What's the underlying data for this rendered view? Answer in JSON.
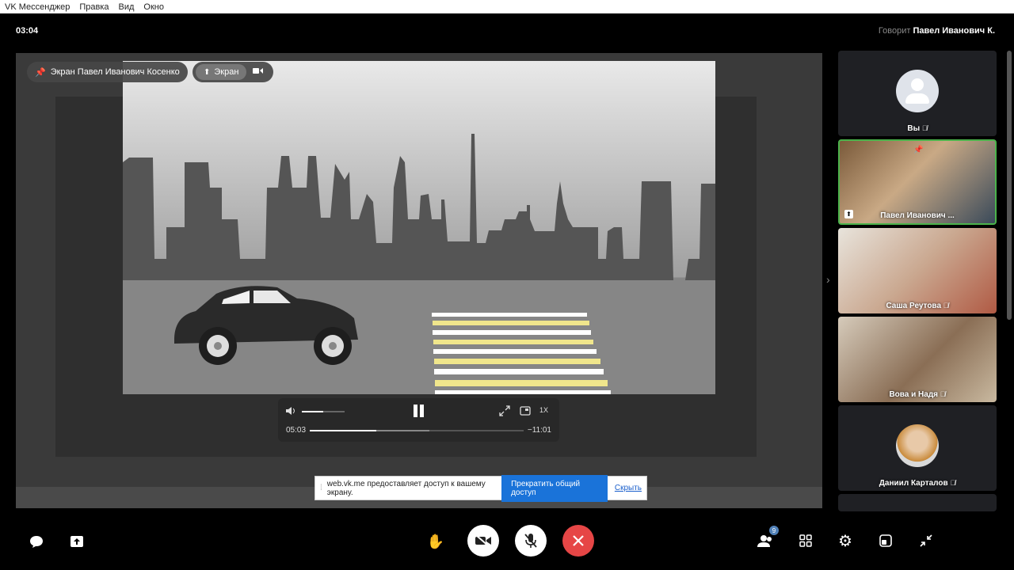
{
  "menubar": {
    "items": [
      "VK Мессенджер",
      "Правка",
      "Вид",
      "Окно"
    ]
  },
  "call": {
    "timer": "03:04",
    "speaking_label": "Говорит",
    "speaking_name": "Павел Иванович К."
  },
  "screen_share": {
    "chip_label": "Экран Павел Иванович Косенко",
    "toggle_label": "Экран"
  },
  "player": {
    "elapsed": "05:03",
    "remaining": "−11:01",
    "speed": "1X",
    "volume_fraction": 0.5,
    "progress_fraction": 0.31
  },
  "share_notice": {
    "message": "web.vk.me предоставляет доступ к вашему экрану.",
    "stop_button": "Прекратить общий доступ",
    "hide_link": "Скрыть"
  },
  "participants": [
    {
      "name": "Вы",
      "muted": true,
      "type": "avatar"
    },
    {
      "name": "Павел Иванович ...",
      "muted": false,
      "type": "video",
      "active": true
    },
    {
      "name": "Саша Реутова",
      "muted": true,
      "type": "video"
    },
    {
      "name": "Вова и Надя",
      "muted": true,
      "type": "video"
    },
    {
      "name": "Даниил Карталов",
      "muted": true,
      "type": "avatar"
    }
  ],
  "bottom_bar": {
    "participants_count": "9"
  },
  "colors": {
    "active_tile_border": "#4bb34b",
    "end_call": "#e64646",
    "accent": "#1a73d9"
  }
}
